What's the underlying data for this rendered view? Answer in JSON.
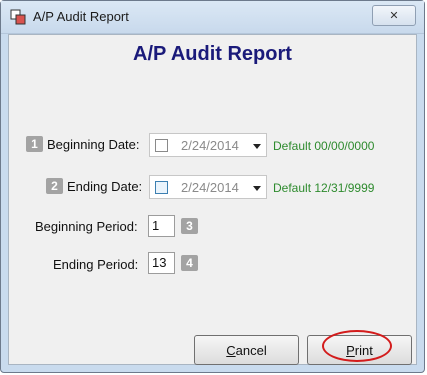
{
  "window": {
    "title": "A/P Audit Report",
    "close_glyph": "✕"
  },
  "report": {
    "heading": "A/P Audit Report"
  },
  "rows": {
    "beginning_date": {
      "step": "1",
      "label": "Beginning Date:",
      "value": "2/24/2014",
      "default_hint": "Default 00/00/0000"
    },
    "ending_date": {
      "step": "2",
      "label": "Ending Date:",
      "value": "2/24/2014",
      "default_hint": "Default 12/31/9999"
    },
    "beginning_period": {
      "step": "3",
      "label": "Beginning Period:",
      "value": "1"
    },
    "ending_period": {
      "step": "4",
      "label": "Ending Period:",
      "value": "13"
    }
  },
  "buttons": {
    "cancel": {
      "underlined_key": "C",
      "rest": "ancel"
    },
    "print": {
      "underlined_key": "P",
      "rest": "rint"
    }
  },
  "colors": {
    "heading": "#1a1a7a",
    "hint": "#2e8b2e",
    "highlight_oval": "#d31c1c"
  }
}
